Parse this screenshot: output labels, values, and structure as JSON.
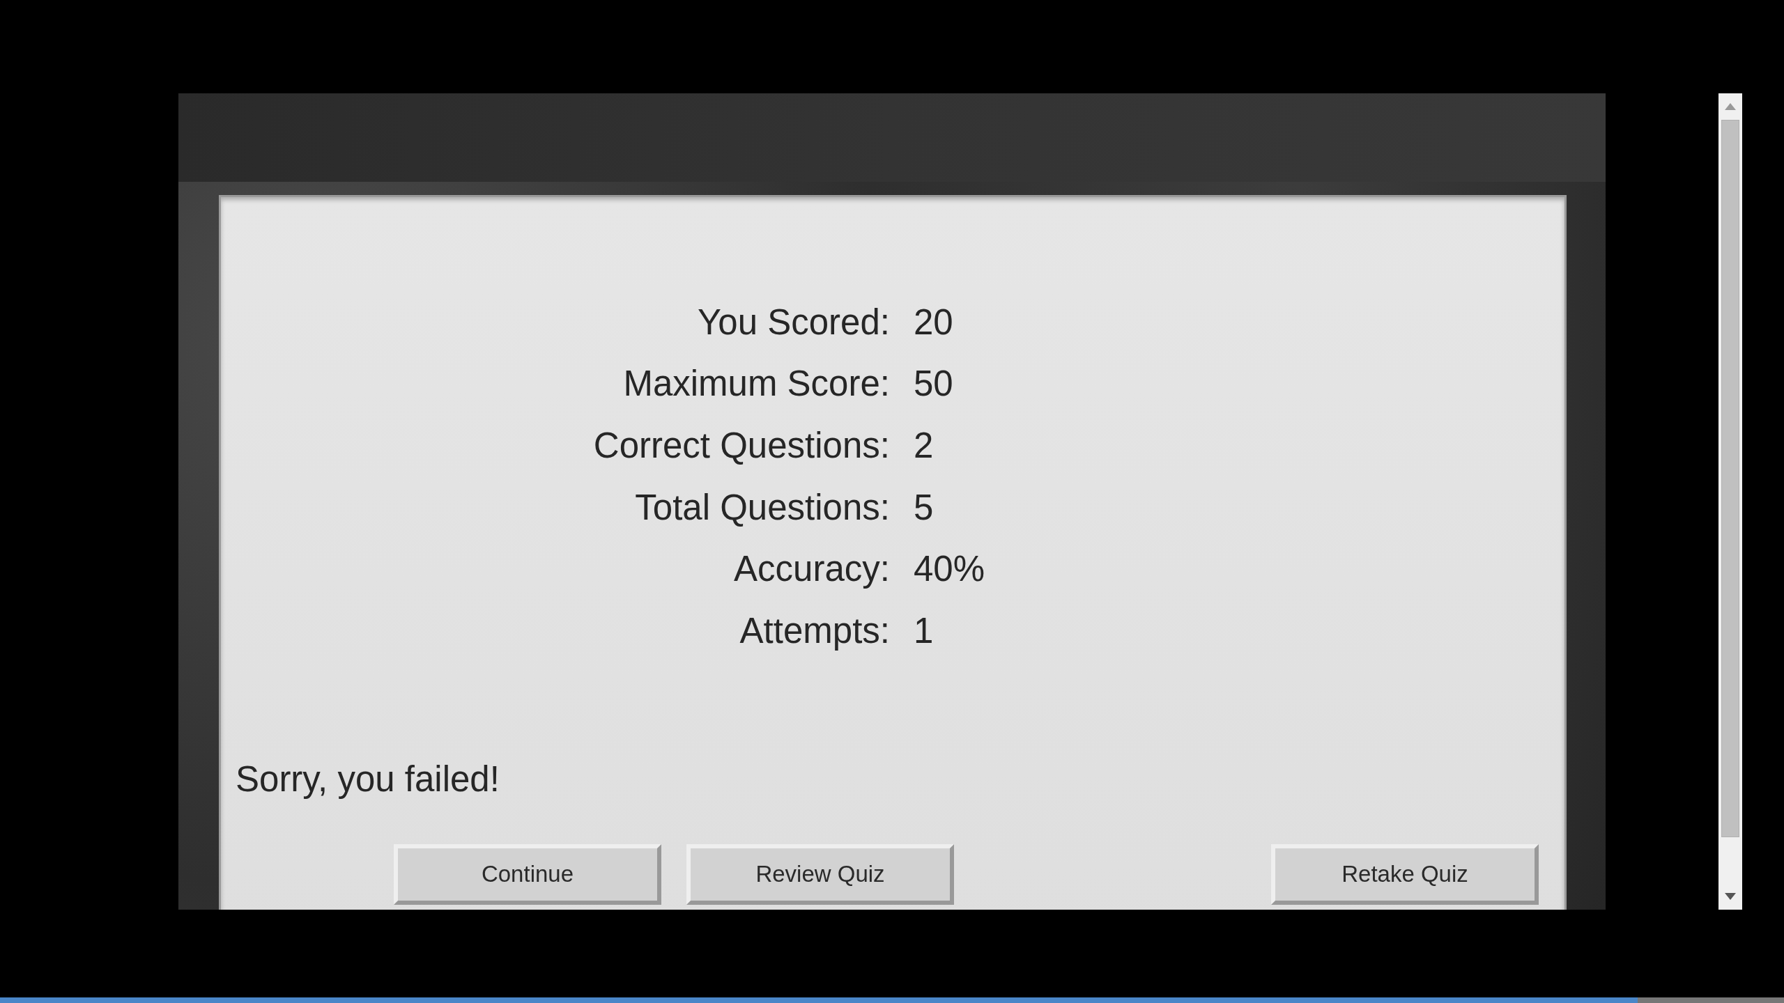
{
  "results": [
    {
      "label": "You Scored:",
      "value": "20"
    },
    {
      "label": "Maximum Score:",
      "value": "50"
    },
    {
      "label": "Correct Questions:",
      "value": "2"
    },
    {
      "label": "Total Questions:",
      "value": "5"
    },
    {
      "label": "Accuracy:",
      "value": "40%"
    },
    {
      "label": "Attempts:",
      "value": "1"
    }
  ],
  "message": "Sorry, you failed!",
  "buttons": [
    {
      "label": "Continue",
      "kind": "left"
    },
    {
      "label": "Review Quiz",
      "kind": "left"
    },
    {
      "label": "Retake Quiz",
      "kind": "right"
    }
  ]
}
